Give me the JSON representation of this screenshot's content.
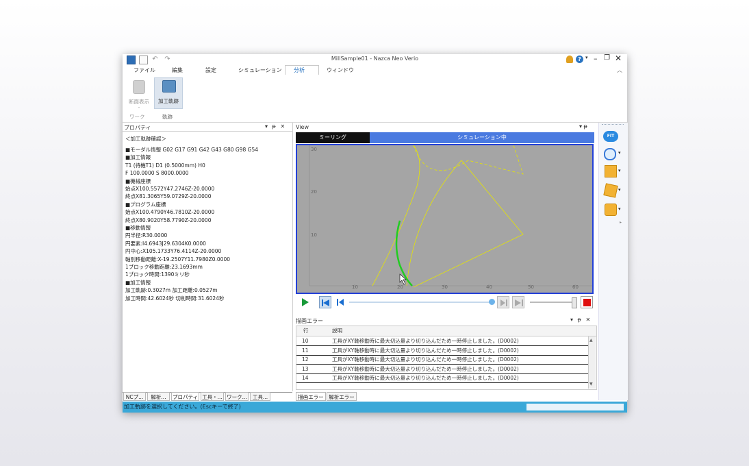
{
  "window": {
    "title": "MillSample01 - Nazca Neo Verio",
    "controls": {
      "min": "–",
      "max": "❐",
      "close": "✕"
    }
  },
  "menu": {
    "items": [
      "ファイル",
      "編集",
      "設定",
      "シミュレーション",
      "分析",
      "ウィンドウ"
    ],
    "active_index": 4
  },
  "ribbon": {
    "buttons": [
      {
        "label": "断面表示",
        "sub": "-",
        "group": "ワーク",
        "enabled": false
      },
      {
        "label": "加工軌跡",
        "group": "軌跡",
        "enabled": true
      }
    ]
  },
  "properties": {
    "header": "プロパティ",
    "pin": "▾ ᵽ ✕",
    "subtitle": "＜加工軌跡確認＞",
    "lines": [
      "■モーダル情報 G02 G17 G91 G42 G43 G80 G98 G54",
      "■加工情報",
      "T1 (待機T1) D1 (0.5000mm) H0",
      "F 100.0000 S 8000.0000",
      "■機械座標",
      "始点X100.5572Y47.2746Z-20.0000",
      "終点X81.3065Y59.0729Z-20.0000",
      "■プログラム座標",
      "始点X100.4790Y46.7810Z-20.0000",
      "終点X80.9020Y58.7790Z-20.0000",
      "■移動情報",
      "円半径:R30.0000",
      "円要素:I4.6943J29.6304K0.0000",
      "円中心:X105.1733Y76.4114Z-20.0000",
      "軸別移動距離:X-19.2507Y11.7980Z0.0000",
      "1ブロック移動距離:23.1693mm",
      "1ブロック時間:1390ミリ秒",
      "■加工情報",
      "加工軌跡:0.3027m 加工距離:0.0527m",
      "加工時間:42.6024秒 切削時間:31.6024秒"
    ],
    "tabs": [
      "NCプ...",
      "解析...",
      "プロパティ",
      "工具・...",
      "ワーク...",
      "工具..."
    ],
    "active_tab": 2
  },
  "view": {
    "header": "View",
    "mode_label": "ミーリング",
    "status_label": "シミュレーション中",
    "axis": {
      "x_ticks": [
        "10",
        "20",
        "30",
        "40",
        "50",
        "60"
      ],
      "y_ticks": [
        "30",
        "20",
        "10"
      ]
    }
  },
  "errors": {
    "header": "描画エラー",
    "columns": [
      "行",
      "説明"
    ],
    "rows": [
      {
        "line": "10",
        "desc": "工具がXY軸移動時に最大切込量より切り込んだため一時停止しました。(D0002)"
      },
      {
        "line": "11",
        "desc": "工具がXY軸移動時に最大切込量より切り込んだため一時停止しました。(D0002)"
      },
      {
        "line": "12",
        "desc": "工具がXY軸移動時に最大切込量より切り込んだため一時停止しました。(D0002)"
      },
      {
        "line": "13",
        "desc": "工具がXY軸移動時に最大切込量より切り込んだため一時停止しました。(D0002)"
      },
      {
        "line": "14",
        "desc": "工具がXY軸移動時に最大切込量より切り込んだため一時停止しました。(D0002)"
      }
    ],
    "tabs": [
      "描画エラー",
      "解析エラー"
    ]
  },
  "status": {
    "text": "加工軌跡を選択してください。(Escキーで終了)"
  },
  "colors": {
    "accent": "#2b75c2",
    "status": "#3aa8d8",
    "viewport": "#a5a5a5",
    "mode_bar": "#111111",
    "sim_bar": "#4a7ae0",
    "path": "#e6e600",
    "tool": "#22cc22"
  }
}
